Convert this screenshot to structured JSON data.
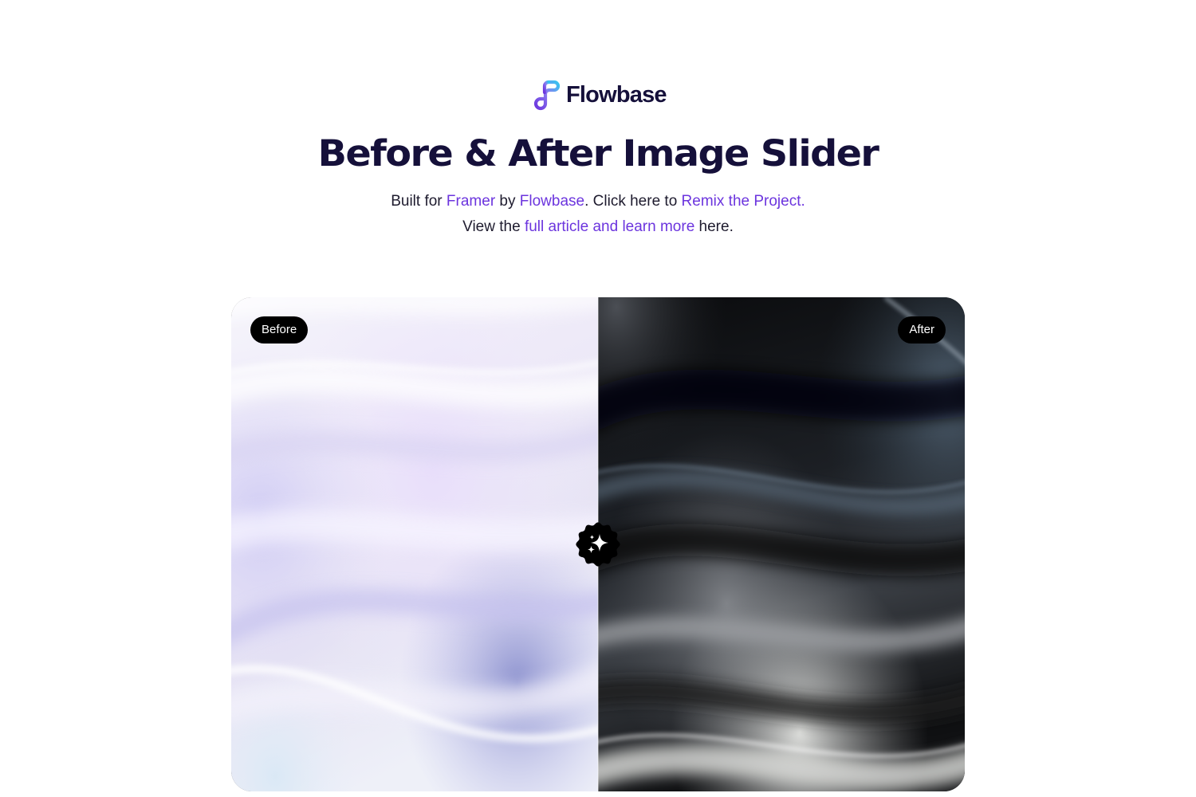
{
  "brand": {
    "name": "Flowbase",
    "colors": {
      "logo_gradient_start": "#6c35de",
      "logo_gradient_end": "#35c5f0",
      "heading": "#15103a",
      "link": "#6c35de",
      "body_text": "#1e1b2e"
    }
  },
  "header": {
    "title": "Before & After Image Slider",
    "line1": {
      "prefix": "Built for ",
      "framer_link": "Framer",
      "middle": " by ",
      "flowbase_link": "Flowbase",
      "after_flowbase": ". Click here to ",
      "remix_link": "Remix the Project."
    },
    "line2": {
      "prefix": "View the ",
      "article_link": "full article and learn more",
      "suffix": " here."
    }
  },
  "slider": {
    "before_label": "Before",
    "after_label": "After",
    "position_percent": 50,
    "handle_icon": "sparkles-icon",
    "before_image": "light lavender silk waves",
    "after_image": "dark monochrome silk waves"
  }
}
